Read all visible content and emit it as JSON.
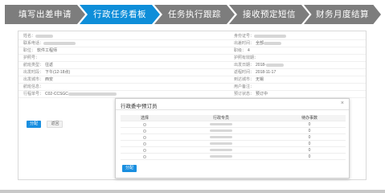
{
  "steps": [
    {
      "label": "填写出差申请",
      "active": false
    },
    {
      "label": "行政任务看板",
      "active": true
    },
    {
      "label": "任务执行跟踪",
      "active": false
    },
    {
      "label": "接收预定短信",
      "active": false
    },
    {
      "label": "财务月度结算",
      "active": false
    }
  ],
  "form": {
    "rows": [
      {
        "left_label": "姓名：",
        "left_value": "",
        "right_label": "身份证号：",
        "right_value": ""
      },
      {
        "left_label": "联系电话：",
        "left_value": "",
        "right_label": "出差时间：",
        "right_value": "全部"
      },
      {
        "left_label": "职位：",
        "left_value": "软件工程师",
        "right_label": "职级：",
        "right_value": "4"
      },
      {
        "left_label": "护照号：",
        "left_value": "",
        "right_label": "护照有效期：",
        "right_value": ""
      },
      {
        "left_label": "航班类型：",
        "left_value": "往返",
        "right_label": "出发日期：",
        "right_value": "2018-"
      },
      {
        "left_label": "出发时段：",
        "left_value": "下午(12-18点)",
        "right_label": "返程时间：",
        "right_value": "2018-11-17"
      },
      {
        "left_label": "出发城市：",
        "left_value": "西安",
        "right_label": "到达城市：",
        "right_value": "无锡"
      },
      {
        "left_label": "航班信息：",
        "left_value": "",
        "right_label": "用户备注：",
        "right_value": ""
      },
      {
        "left_label": "行程单号：",
        "left_value": "C02-CCSGC",
        "right_label": "预订状态：",
        "right_value": "预订中"
      }
    ],
    "confirm_label": "分配",
    "return_label": "返回"
  },
  "modal": {
    "title": "行政委中预订员",
    "close": "×",
    "headers": [
      "选择",
      "行政专员",
      "待办事数"
    ],
    "rows": [
      {
        "name": "",
        "count": "0"
      },
      {
        "name": "",
        "count": "0"
      },
      {
        "name": "",
        "count": "0"
      },
      {
        "name": "",
        "count": "0"
      },
      {
        "name": "",
        "count": "0"
      },
      {
        "name": "",
        "count": "0"
      }
    ],
    "submit_label": "分配"
  },
  "colors": {
    "active_step": "#0e8ed9",
    "inactive_step": "#7d7d7d",
    "primary_button": "#1a8fe0"
  }
}
